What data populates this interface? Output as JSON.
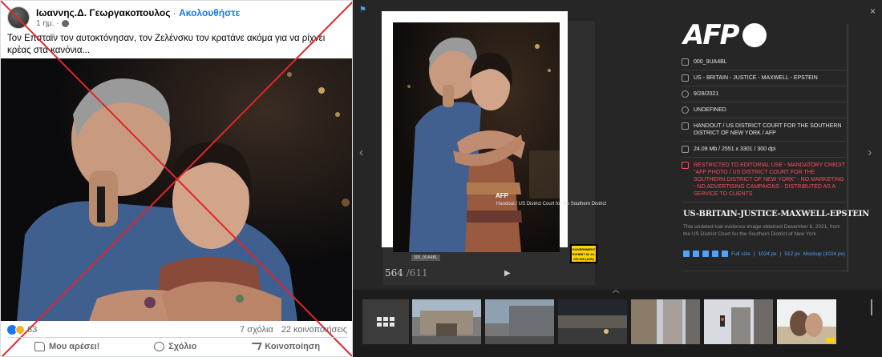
{
  "facebook_post": {
    "author": "Ιωαννης.Δ. Γεωργακοπουλος",
    "separator": " · ",
    "follow_label": "Ακολουθήστε",
    "time": "1 ημ.",
    "time_sep": "·",
    "text": "Τον Επσταϊν τον αυτοκτόνησαν, τον Ζελένσκυ τον κρατάνε ακόμα για να ρίχνει κρέας στα κανόνια...",
    "reaction_count": "63",
    "comments": "7 σχόλια",
    "shares": "22 κοινοποιήσεις",
    "actions": {
      "like": "Μου αρέσει!",
      "comment": "Σχόλιο",
      "share": "Κοινοποίηση"
    },
    "icons": [
      "avatar",
      "globe-icon",
      "like-icon",
      "haha-icon",
      "thumb-icon",
      "comment-icon",
      "share-icon"
    ],
    "overlay_color": "#e0262c"
  },
  "afp_viewer": {
    "logo": "AFP",
    "close": "×",
    "pin": "⚑",
    "prev": "‹",
    "next": "›",
    "counter_current": "564",
    "counter_total": "/611",
    "play": "▶",
    "watermark": "AFP",
    "handout_overlay": "Handout / US District Court for the Southern District",
    "exhibit_tag": "GOVERNMENT EXHIBIT 52 20-CR-330 (AJN)",
    "image_id_tag": "000_9UA4BL",
    "metadata": [
      {
        "icon": "id-icon",
        "value": "000_9UA4BL"
      },
      {
        "icon": "keyword-icon",
        "value": "US - BRITAIN - JUSTICE - MAXWELL - EPSTEIN"
      },
      {
        "icon": "clock-icon",
        "value": "9/28/2021"
      },
      {
        "icon": "globe-icon",
        "value": "UNDEFINED"
      },
      {
        "icon": "credit-icon",
        "value": "HANDOUT / US DISTRICT COURT FOR THE SOUTHERN DISTRICT OF NEW YORK / AFP"
      },
      {
        "icon": "size-icon",
        "value": "24.09 Mb / 2551 x 3301 / 300 dpi"
      }
    ],
    "restriction": "RESTRICTED TO EDITORIAL USE - MANDATORY CREDIT \"AFP PHOTO / US DISTRICT COURT FOR THE SOUTHERN DISTRICT OF NEW YORK\" - NO MARKETING - NO ADVERTISING CAMPAIGNS - DISTRIBUTED AS A SERVICE TO CLIENTS",
    "title": "US-BRITAIN-JUSTICE-MAXWELL-EPSTEIN",
    "caption": "This undated trial evidence image obtained December 8, 2021, from the US District Court for the Southern District of New York",
    "downloads": {
      "full": "Full size",
      "sep": "|",
      "px1024": "1024 px",
      "px512": "512 px",
      "mockup": "Mockup (1024 px)"
    },
    "strip_toggle": "︿",
    "accent": "#4fa3ff",
    "restricted_color": "#ff4a5c"
  }
}
